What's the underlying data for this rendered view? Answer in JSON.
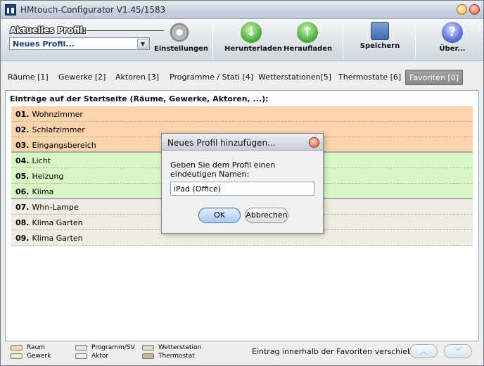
{
  "window": {
    "title": "HMtouch-Configurator V1.45/1583"
  },
  "toolbar": {
    "profile_label": "Aktuelles Profil:",
    "profile_value": "Neues Profil...",
    "buttons": [
      "Einstellungen",
      "Herunterladen",
      "Heraufladen",
      "Speichern",
      "Über..."
    ]
  },
  "tabs": [
    {
      "label": "Räume [1]"
    },
    {
      "label": "Gewerke [2]"
    },
    {
      "label": "Aktoren [3]"
    },
    {
      "label": "Programme / Stati [4]"
    },
    {
      "label": "Wetterstationen[5]"
    },
    {
      "label": "Thermostate [6]"
    },
    {
      "label": "Favoriten [0]",
      "active": true
    }
  ],
  "panel": {
    "title": "Einträge auf der Startseite (Räume, Gewerke, Aktoren, ...):",
    "rows": [
      {
        "num": "01.",
        "name": "Wohnzimmer",
        "type": "raum"
      },
      {
        "num": "02.",
        "name": "Schlafzimmer",
        "type": "raum"
      },
      {
        "num": "03.",
        "name": "Eingangsbereich",
        "type": "raum"
      },
      {
        "num": "04.",
        "name": "Licht",
        "type": "gewerk"
      },
      {
        "num": "05.",
        "name": "Heizung",
        "type": "gewerk"
      },
      {
        "num": "06.",
        "name": "Klima",
        "type": "gewerk"
      },
      {
        "num": "07.",
        "name": "Whn-Lampe",
        "type": "aktor"
      },
      {
        "num": "08.",
        "name": "Klima Garten",
        "type": "aktor"
      },
      {
        "num": "09.",
        "name": "Klima Garten",
        "type": "aktor"
      }
    ]
  },
  "legend": {
    "items": [
      {
        "label": "Raum",
        "color": "#fbd3ad"
      },
      {
        "label": "Gewerk",
        "color": "#d9f7c6"
      },
      {
        "label": "Programm/SV",
        "color": "#dfe8f8"
      },
      {
        "label": "Aktor",
        "color": "#efece3"
      },
      {
        "label": "Wetterstation",
        "color": "#e6dcc6"
      },
      {
        "label": "Thermostat",
        "color": "#c9b98e"
      }
    ],
    "move_label": "Eintrag innerhalb der Favoriten verschieben:"
  },
  "dialog": {
    "title": "Neues Profil hinzufügen...",
    "message": "Geben Sie dem Profil einen eindeutigen Namen:",
    "input_value": "iPad (Office)",
    "ok_label": "OK",
    "cancel_label": "Abbrechen"
  }
}
